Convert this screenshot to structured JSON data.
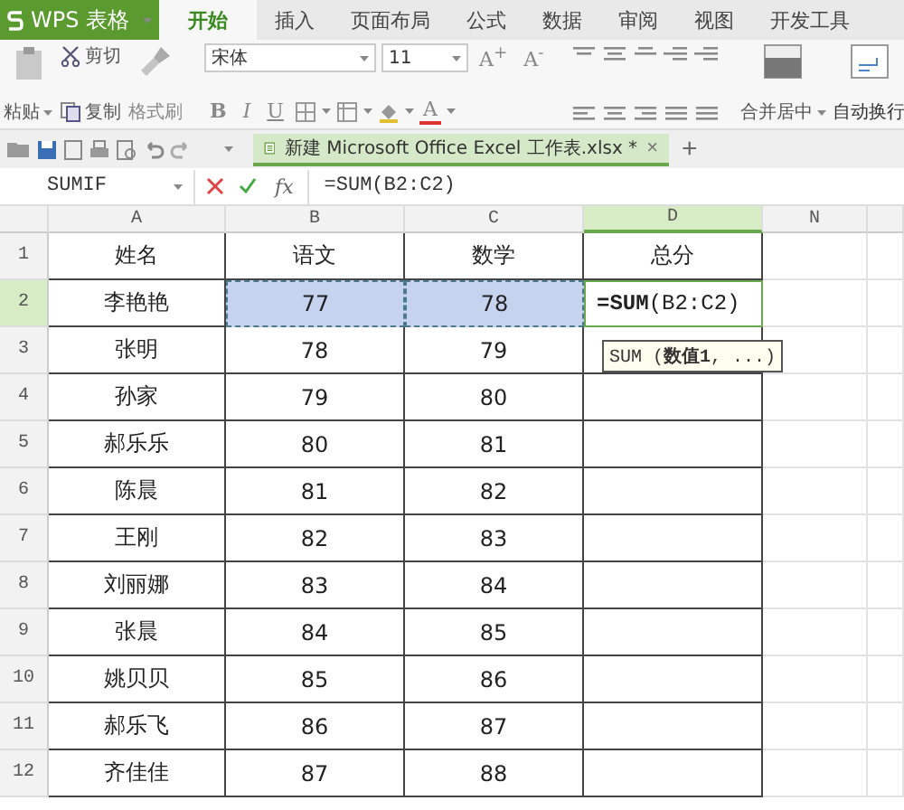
{
  "app": {
    "name": "WPS 表格"
  },
  "menu_tabs": [
    {
      "label": "开始",
      "selected": true
    },
    {
      "label": "插入",
      "selected": false
    },
    {
      "label": "页面布局",
      "selected": false
    },
    {
      "label": "公式",
      "selected": false
    },
    {
      "label": "数据",
      "selected": false
    },
    {
      "label": "审阅",
      "selected": false
    },
    {
      "label": "视图",
      "selected": false
    },
    {
      "label": "开发工具",
      "selected": false
    }
  ],
  "ribbon": {
    "paste": "粘贴",
    "cut": "剪切",
    "copy": "复制",
    "format_painter": "格式刷",
    "font_name": "宋体",
    "font_size": "11",
    "grow_font": "A$^{+}$",
    "shrink_font": "A$^{-}$",
    "bold": "B",
    "italic": "I",
    "underline": "U",
    "font_color": "A",
    "merge": "合并居中",
    "wrap": "自动换行"
  },
  "document_tab": {
    "title": "新建 Microsoft Office Excel 工作表.xlsx *",
    "close": "×"
  },
  "new_tab": "+",
  "formula_bar": {
    "name_box": "SUMIF",
    "fx": "fx",
    "formula": "=SUM(B2:C2)"
  },
  "sheet": {
    "columns": [
      {
        "label": "A",
        "selected": false
      },
      {
        "label": "B",
        "selected": false
      },
      {
        "label": "C",
        "selected": false
      },
      {
        "label": "D",
        "selected": true
      },
      {
        "label": "N",
        "selected": false
      }
    ],
    "rows": [
      {
        "number": "1",
        "selected": false,
        "cells": [
          {
            "text": "姓名",
            "referenced": false
          },
          {
            "text": "语文",
            "referenced": false
          },
          {
            "text": "数学",
            "referenced": false
          },
          {
            "text": "总分",
            "referenced": false
          }
        ]
      },
      {
        "number": "2",
        "selected": true,
        "cells": [
          {
            "text": "李艳艳",
            "referenced": false
          },
          {
            "text": "77",
            "referenced": true
          },
          {
            "text": "78",
            "referenced": true
          },
          {
            "text": "**=SUM**(B2:C2)",
            "referenced": false
          }
        ]
      },
      {
        "number": "3",
        "selected": false,
        "cells": [
          {
            "text": "张明",
            "referenced": false
          },
          {
            "text": "78",
            "referenced": false
          },
          {
            "text": "79",
            "referenced": false
          },
          {
            "text": "",
            "referenced": false
          }
        ]
      },
      {
        "number": "4",
        "selected": false,
        "cells": [
          {
            "text": "孙家",
            "referenced": false
          },
          {
            "text": "79",
            "referenced": false
          },
          {
            "text": "80",
            "referenced": false
          },
          {
            "text": "",
            "referenced": false
          }
        ]
      },
      {
        "number": "5",
        "selected": false,
        "cells": [
          {
            "text": "郝乐乐",
            "referenced": false
          },
          {
            "text": "80",
            "referenced": false
          },
          {
            "text": "81",
            "referenced": false
          },
          {
            "text": "",
            "referenced": false
          }
        ]
      },
      {
        "number": "6",
        "selected": false,
        "cells": [
          {
            "text": "陈晨",
            "referenced": false
          },
          {
            "text": "81",
            "referenced": false
          },
          {
            "text": "82",
            "referenced": false
          },
          {
            "text": "",
            "referenced": false
          }
        ]
      },
      {
        "number": "7",
        "selected": false,
        "cells": [
          {
            "text": "王刚",
            "referenced": false
          },
          {
            "text": "82",
            "referenced": false
          },
          {
            "text": "83",
            "referenced": false
          },
          {
            "text": "",
            "referenced": false
          }
        ]
      },
      {
        "number": "8",
        "selected": false,
        "cells": [
          {
            "text": "刘丽娜",
            "referenced": false
          },
          {
            "text": "83",
            "referenced": false
          },
          {
            "text": "84",
            "referenced": false
          },
          {
            "text": "",
            "referenced": false
          }
        ]
      },
      {
        "number": "9",
        "selected": false,
        "cells": [
          {
            "text": "张晨",
            "referenced": false
          },
          {
            "text": "84",
            "referenced": false
          },
          {
            "text": "85",
            "referenced": false
          },
          {
            "text": "",
            "referenced": false
          }
        ]
      },
      {
        "number": "10",
        "selected": false,
        "cells": [
          {
            "text": "姚贝贝",
            "referenced": false
          },
          {
            "text": "85",
            "referenced": false
          },
          {
            "text": "86",
            "referenced": false
          },
          {
            "text": "",
            "referenced": false
          }
        ]
      },
      {
        "number": "11",
        "selected": false,
        "cells": [
          {
            "text": "郝乐飞",
            "referenced": false
          },
          {
            "text": "86",
            "referenced": false
          },
          {
            "text": "87",
            "referenced": false
          },
          {
            "text": "",
            "referenced": false
          }
        ]
      },
      {
        "number": "12",
        "selected": false,
        "cells": [
          {
            "text": "齐佳佳",
            "referenced": false
          },
          {
            "text": "87",
            "referenced": false
          },
          {
            "text": "88",
            "referenced": false
          },
          {
            "text": "",
            "referenced": false
          }
        ]
      }
    ],
    "tooltip": "SUM (**数值1**, ...)"
  }
}
